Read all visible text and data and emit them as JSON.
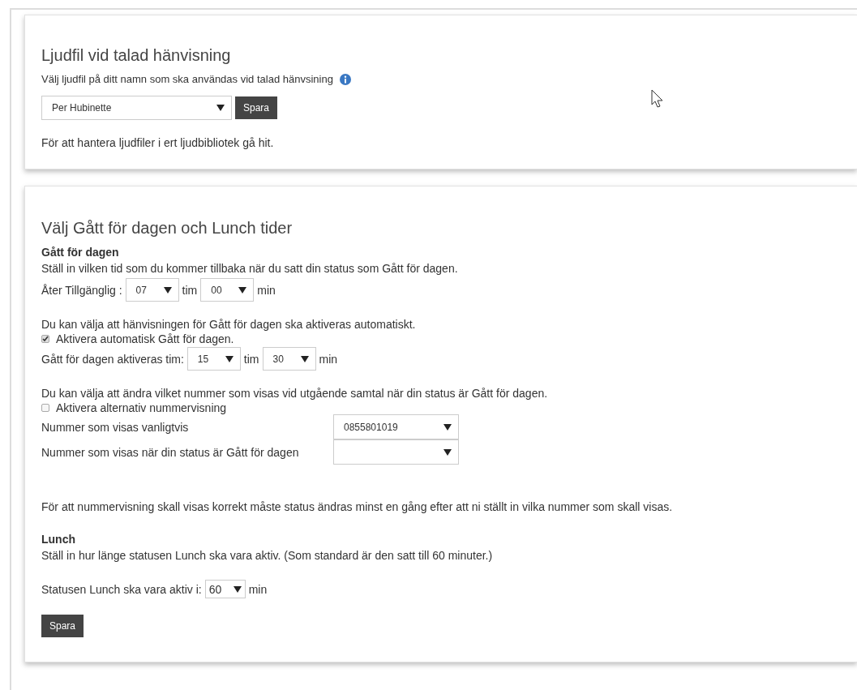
{
  "sound_file": {
    "title": "Ljudfil vid talad hänvisning",
    "description": "Välj ljudfil på ditt namn som ska användas vid talad hänvsining",
    "select": {
      "value": "Per Hubinette"
    },
    "save_button": "Spara",
    "note": "För att hantera ljudfiler i ert ljudbibliotek gå hit."
  },
  "schedule": {
    "title": "Välj Gått för dagen och Lunch tider",
    "gone_heading": "Gått för dagen",
    "gone_description": "Ställ in vilken tid som du kommer tillbaka när du satt din status som Gått för dagen.",
    "return_row": {
      "label": "Åter Tillgänglig :",
      "hour": "07",
      "hour_unit": "tim",
      "minute": "00",
      "minute_unit": "min"
    },
    "auto_description": "Du kan välja att hänvisningen för Gått för dagen ska aktiveras automatiskt.",
    "auto_checkbox": {
      "label": "Aktivera automatisk Gått för dagen.",
      "checked": true
    },
    "auto_row": {
      "label": "Gått för dagen aktiveras tim:",
      "hour": "15",
      "hour_unit": "tim",
      "minute": "30",
      "minute_unit": "min"
    },
    "number_description": "Du kan välja att ändra vilket nummer som visas vid utgående samtal när din status är Gått för dagen.",
    "number_checkbox": {
      "label": "Aktivera alternativ nummervisning",
      "checked": false
    },
    "number_rows": [
      {
        "label": "Nummer som visas vanligtvis",
        "value": "0855801019"
      },
      {
        "label": "Nummer som visas när din status är Gått för dagen"
      }
    ],
    "number_note": "För att nummervisning skall visas korrekt måste status ändras minst en gång efter att ni ställt in vilka nummer som skall visas.",
    "lunch_heading": "Lunch",
    "lunch_description": "Ställ in hur länge statusen Lunch ska vara aktiv. (Som standard är den satt till 60 minuter.)",
    "lunch_row": {
      "label": "Statusen Lunch ska vara aktiv i:",
      "value": "60",
      "unit": "min"
    },
    "save_button": "Spara"
  }
}
